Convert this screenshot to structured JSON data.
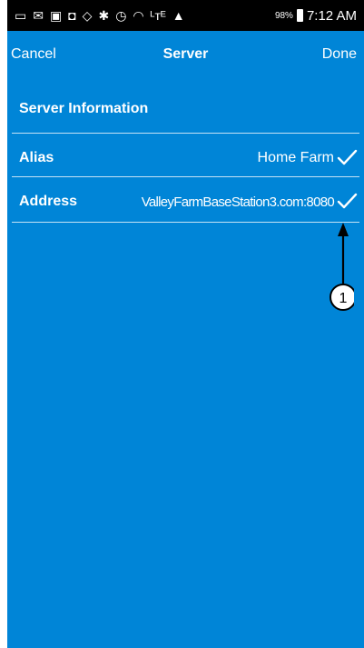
{
  "status_bar": {
    "icons": [
      "message-icon",
      "email-icon",
      "image-icon",
      "android-icon",
      "location-icon",
      "bluetooth-icon",
      "alarm-icon",
      "wifi-icon",
      "4g-icon",
      "signal-icon"
    ],
    "icon_glyphs": [
      "▭",
      "✉",
      "▣",
      "◘",
      "◇",
      "✱",
      "◷",
      "◠",
      "ᴸᴛᴱ",
      "▲"
    ],
    "battery_percent": "98%",
    "time": "7:12 AM"
  },
  "navbar": {
    "cancel_label": "Cancel",
    "title": "Server",
    "done_label": "Done"
  },
  "section": {
    "title": "Server Information"
  },
  "fields": {
    "alias": {
      "label": "Alias",
      "value": "Home Farm"
    },
    "address": {
      "label": "Address",
      "value": "ValleyFarmBaseStation3.com:8080"
    }
  },
  "callout": {
    "number": "1"
  },
  "colors": {
    "background": "#0085d7",
    "divider": "#c5e3f6",
    "text": "#ffffff",
    "status_bar": "#000000"
  }
}
